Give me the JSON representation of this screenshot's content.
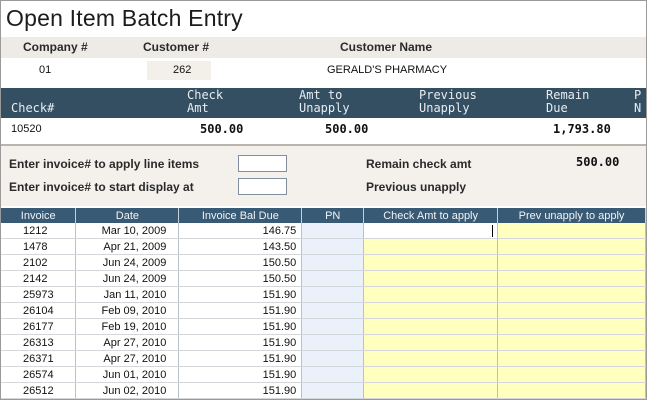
{
  "title": "Open Item Batch Entry",
  "header": {
    "company_label": "Company #",
    "customer_label": "Customer #",
    "customer_name_label": "Customer Name",
    "company_value": "01",
    "customer_value": "262",
    "customer_name_value": "GERALD'S PHARMACY"
  },
  "check_table": {
    "columns": [
      {
        "line1": "",
        "line2": "Check#"
      },
      {
        "line1": "Check",
        "line2": "Amt"
      },
      {
        "line1": "Amt to",
        "line2": "Unapply"
      },
      {
        "line1": "Previous",
        "line2": "Unapply"
      },
      {
        "line1": "Remain",
        "line2": "Due"
      },
      {
        "line1": "P",
        "line2": "N"
      }
    ],
    "check_no": "10520",
    "check_amt": "500.00",
    "amt_to_unapply": "500.00",
    "previous_unapply": "",
    "remain_due": "1,793.80"
  },
  "entry": {
    "apply_label": "Enter invoice# to apply line items",
    "display_label": "Enter invoice# to start display at",
    "apply_value": "",
    "display_value": "",
    "remain_check_label": "Remain check amt",
    "remain_check_value": "500.00",
    "previous_unapply_label": "Previous unapply",
    "previous_unapply_value": ""
  },
  "grid": {
    "columns": [
      "Invoice",
      "Date",
      "Invoice Bal Due",
      "PN",
      "Check Amt to apply",
      "Prev unapply to apply"
    ],
    "rows": [
      {
        "invoice": "1212",
        "date": "Mar 10, 2009",
        "bal": "146.75",
        "pn": "",
        "check": "",
        "prev": ""
      },
      {
        "invoice": "1478",
        "date": "Apr 21, 2009",
        "bal": "143.50",
        "pn": "",
        "check": "",
        "prev": ""
      },
      {
        "invoice": "2102",
        "date": "Jun 24, 2009",
        "bal": "150.50",
        "pn": "",
        "check": "",
        "prev": ""
      },
      {
        "invoice": "2142",
        "date": "Jun 24, 2009",
        "bal": "150.50",
        "pn": "",
        "check": "",
        "prev": ""
      },
      {
        "invoice": "25973",
        "date": "Jan 11, 2010",
        "bal": "151.90",
        "pn": "",
        "check": "",
        "prev": ""
      },
      {
        "invoice": "26104",
        "date": "Feb 09, 2010",
        "bal": "151.90",
        "pn": "",
        "check": "",
        "prev": ""
      },
      {
        "invoice": "26177",
        "date": "Feb 19, 2010",
        "bal": "151.90",
        "pn": "",
        "check": "",
        "prev": ""
      },
      {
        "invoice": "26313",
        "date": "Apr 27, 2010",
        "bal": "151.90",
        "pn": "",
        "check": "",
        "prev": ""
      },
      {
        "invoice": "26371",
        "date": "Apr 27, 2010",
        "bal": "151.90",
        "pn": "",
        "check": "",
        "prev": ""
      },
      {
        "invoice": "26574",
        "date": "Jun 01, 2010",
        "bal": "151.90",
        "pn": "",
        "check": "",
        "prev": ""
      },
      {
        "invoice": "26512",
        "date": "Jun 02, 2010",
        "bal": "151.90",
        "pn": "",
        "check": "",
        "prev": ""
      }
    ]
  },
  "colors": {
    "band_blue": "#344f62",
    "grid_header_blue": "#385a74",
    "editable_yellow": "#ffffc0",
    "pn_blue": "#eaf1fa",
    "panel_beige": "#f4f1ed"
  }
}
